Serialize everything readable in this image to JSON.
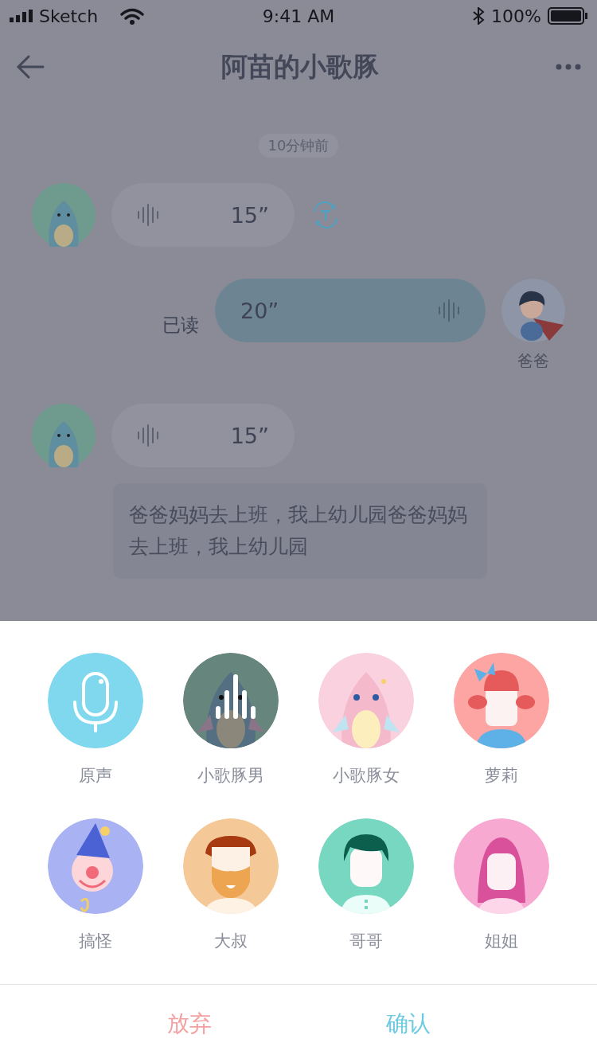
{
  "status_bar": {
    "carrier": "Sketch",
    "time": "9:41 AM",
    "battery": "100%"
  },
  "nav": {
    "title": "阿苗的小歌豚"
  },
  "chat": {
    "timestamp": "10分钟前",
    "messages": [
      {
        "kind": "incoming-voice",
        "duration": "15”",
        "transcribe": true
      },
      {
        "kind": "outgoing-voice",
        "duration": "20”",
        "status": "已读",
        "sender": "爸爸"
      },
      {
        "kind": "incoming-voice",
        "duration": "15”",
        "transcribe": false
      },
      {
        "kind": "text",
        "text": "爸爸妈妈去上班，我上幼儿园爸爸妈妈去上班，我上幼儿园"
      }
    ]
  },
  "voices": [
    {
      "label": "原声",
      "selected": false
    },
    {
      "label": "小歌豚男",
      "selected": true
    },
    {
      "label": "小歌豚女",
      "selected": false
    },
    {
      "label": "萝莉",
      "selected": false
    },
    {
      "label": "搞怪",
      "selected": false
    },
    {
      "label": "大叔",
      "selected": false
    },
    {
      "label": "哥哥",
      "selected": false
    },
    {
      "label": "姐姐",
      "selected": false
    }
  ],
  "actions": {
    "cancel": "放弃",
    "confirm": "确认"
  }
}
